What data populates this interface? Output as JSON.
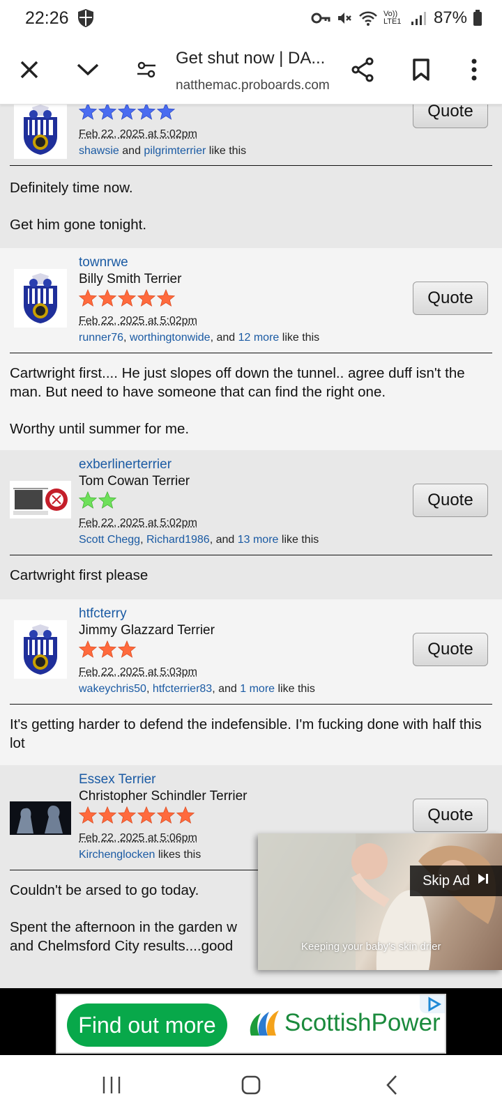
{
  "status_bar": {
    "time": "22:26",
    "network": "Vo)) LTE1",
    "battery": "87%",
    "icons": [
      "shield-icon",
      "key-icon",
      "mute-icon",
      "wifi-icon",
      "signal-icon",
      "battery-icon"
    ]
  },
  "toolbar": {
    "title": "Get shut now | DA...",
    "url": "natthemac.proboards.com",
    "icons": [
      "close-icon",
      "chevron-down-icon",
      "site-settings-icon",
      "share-icon",
      "bookmark-icon",
      "more-icon"
    ]
  },
  "common": {
    "quote_label": "Quote",
    "and": "and",
    "like_this": "like this",
    "likes_this": "likes this"
  },
  "posts": [
    {
      "stars": 5,
      "star_color": "#4a6cf0",
      "date": "Feb 22, 2025 at 5:02pm",
      "likers": [
        "shawsie",
        "pilgrimterrier"
      ],
      "body": [
        "Definitely time now.",
        "Get him gone tonight."
      ]
    },
    {
      "username": "townrwe",
      "rank": "Billy Smith Terrier",
      "stars": 5,
      "star_color": "#ff6a3d",
      "date": "Feb 22, 2025 at 5:02pm",
      "likers": [
        "runner76",
        "worthingtonwide"
      ],
      "more": "12 more",
      "body": [
        "Cartwright first.... He just slopes off down the tunnel.. agree duff isn't the man. But need to have someone that can find the right one.",
        "Worthy until summer for me."
      ]
    },
    {
      "username": "exberlinerterrier",
      "rank": "Tom Cowan Terrier",
      "stars": 2,
      "star_color": "#6ee05a",
      "date": "Feb 22, 2025 at 5:02pm",
      "likers": [
        "Scott Chegg",
        "Richard1986"
      ],
      "more": "13 more",
      "body": [
        "Cartwright first please"
      ]
    },
    {
      "username": "htfcterry",
      "rank": "Jimmy Glazzard Terrier",
      "stars": 3,
      "star_color": "#ff6a3d",
      "date": "Feb 22, 2025 at 5:03pm",
      "likers": [
        "wakeychris50",
        "htfcterrier83"
      ],
      "more": "1 more",
      "body": [
        "It's getting harder to defend the indefensible. I'm fucking done with half this lot"
      ]
    },
    {
      "username": "Essex Terrier",
      "rank": "Christopher Schindler Terrier",
      "stars": 6,
      "star_color": "#ff6a3d",
      "date": "Feb 22, 2025 at 5:06pm",
      "likers": [
        "Kirchenglocken"
      ],
      "body": [
        "Couldn't be arsed to go today.",
        "Spent the afternoon in the garden w",
        "and Chelmsford City results....good"
      ]
    }
  ],
  "video_ad": {
    "skip_label": "Skip Ad",
    "caption": "Keeping your baby's skin drier"
  },
  "banner_ad": {
    "cta": "Find out more",
    "brand": "ScottishPower"
  },
  "navbar": {
    "icons": [
      "recent-apps-icon",
      "home-icon",
      "back-icon"
    ]
  }
}
